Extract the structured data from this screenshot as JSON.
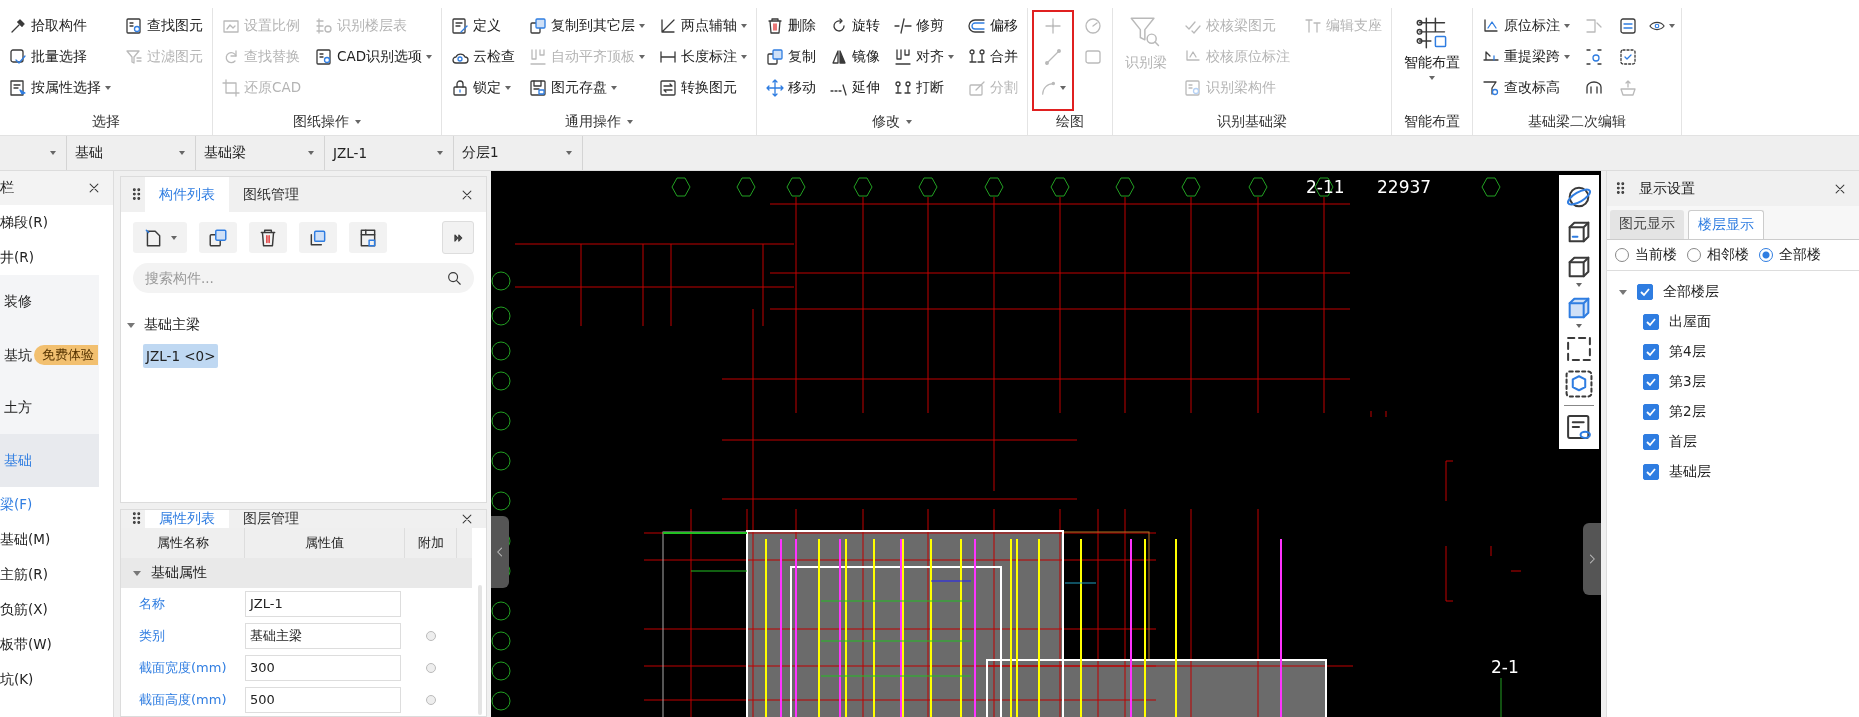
{
  "ribbon": {
    "groups": [
      {
        "label": "选择",
        "has_menu": false,
        "columns": [
          {
            "highlighted": false,
            "items": [
              {
                "kind": "small",
                "label": "拾取构件",
                "disabled": false,
                "has_menu": false
              },
              {
                "kind": "small",
                "label": "批量选择",
                "disabled": false,
                "has_menu": false
              },
              {
                "kind": "small",
                "label": "按属性选择",
                "disabled": false,
                "has_menu": true
              }
            ]
          },
          {
            "highlighted": false,
            "items": [
              {
                "kind": "small",
                "label": "查找图元",
                "disabled": false,
                "has_menu": false
              },
              {
                "kind": "small",
                "label": "过滤图元",
                "disabled": true,
                "has_menu": false
              }
            ]
          }
        ]
      },
      {
        "label": "图纸操作",
        "has_menu": true,
        "columns": [
          {
            "highlighted": false,
            "items": [
              {
                "kind": "small",
                "label": "设置比例",
                "disabled": true,
                "has_menu": false
              },
              {
                "kind": "small",
                "label": "查找替换",
                "disabled": true,
                "has_menu": false
              },
              {
                "kind": "small",
                "label": "还原CAD",
                "disabled": true,
                "has_menu": false
              }
            ]
          },
          {
            "highlighted": false,
            "items": [
              {
                "kind": "small",
                "label": "识别楼层表",
                "disabled": true,
                "has_menu": false
              },
              {
                "kind": "small",
                "label": "CAD识别选项",
                "disabled": false,
                "has_menu": true
              }
            ]
          }
        ]
      },
      {
        "label": "通用操作",
        "has_menu": true,
        "columns": [
          {
            "highlighted": false,
            "items": [
              {
                "kind": "small",
                "label": "定义",
                "disabled": false,
                "has_menu": false
              },
              {
                "kind": "small",
                "label": "云检查",
                "disabled": false,
                "has_menu": false
              },
              {
                "kind": "small",
                "label": "锁定",
                "disabled": false,
                "has_menu": true
              }
            ]
          },
          {
            "highlighted": false,
            "items": [
              {
                "kind": "small",
                "label": "复制到其它层",
                "disabled": false,
                "has_menu": true
              },
              {
                "kind": "small",
                "label": "自动平齐顶板",
                "disabled": true,
                "has_menu": true
              },
              {
                "kind": "small",
                "label": "图元存盘",
                "disabled": false,
                "has_menu": true
              }
            ]
          },
          {
            "highlighted": false,
            "items": [
              {
                "kind": "small",
                "label": "两点辅轴",
                "disabled": false,
                "has_menu": true
              },
              {
                "kind": "small",
                "label": "长度标注",
                "disabled": false,
                "has_menu": true
              },
              {
                "kind": "small",
                "label": "转换图元",
                "disabled": false,
                "has_menu": false
              }
            ]
          }
        ]
      },
      {
        "label": "修改",
        "has_menu": true,
        "columns": [
          {
            "highlighted": false,
            "items": [
              {
                "kind": "small",
                "label": "删除",
                "disabled": false,
                "has_menu": false
              },
              {
                "kind": "small",
                "label": "复制",
                "disabled": false,
                "has_menu": false
              },
              {
                "kind": "small",
                "label": "移动",
                "disabled": false,
                "has_menu": false
              }
            ]
          },
          {
            "highlighted": false,
            "items": [
              {
                "kind": "small",
                "label": "旋转",
                "disabled": false,
                "has_menu": false
              },
              {
                "kind": "small",
                "label": "镜像",
                "disabled": false,
                "has_menu": false
              },
              {
                "kind": "small",
                "label": "延伸",
                "disabled": false,
                "has_menu": false
              }
            ]
          },
          {
            "highlighted": false,
            "items": [
              {
                "kind": "small",
                "label": "修剪",
                "disabled": false,
                "has_menu": false
              },
              {
                "kind": "small",
                "label": "对齐",
                "disabled": false,
                "has_menu": true
              },
              {
                "kind": "small",
                "label": "打断",
                "disabled": false,
                "has_menu": false
              }
            ]
          },
          {
            "highlighted": false,
            "items": [
              {
                "kind": "small",
                "label": "偏移",
                "disabled": false,
                "has_menu": false
              },
              {
                "kind": "small",
                "label": "合并",
                "disabled": false,
                "has_menu": false
              },
              {
                "kind": "small",
                "label": "分割",
                "disabled": true,
                "has_menu": false
              }
            ]
          }
        ]
      },
      {
        "label": "绘图",
        "has_menu": false,
        "columns": [
          {
            "highlighted": true,
            "items": [
              {
                "kind": "icon",
                "disabled": true,
                "has_menu": false
              },
              {
                "kind": "icon",
                "disabled": true,
                "has_menu": false
              },
              {
                "kind": "icon",
                "disabled": true,
                "has_menu": true
              }
            ]
          },
          {
            "highlighted": false,
            "items": [
              {
                "kind": "icon",
                "disabled": true,
                "has_menu": false
              },
              {
                "kind": "icon",
                "disabled": true,
                "has_menu": false
              }
            ]
          }
        ]
      },
      {
        "label": "识别基础梁",
        "has_menu": false,
        "columns": [
          {
            "highlighted": false,
            "items": [
              {
                "kind": "large",
                "label": "识别梁",
                "disabled": true,
                "has_menu": false
              }
            ]
          },
          {
            "highlighted": false,
            "items": [
              {
                "kind": "small",
                "label": "校核梁图元",
                "disabled": true,
                "has_menu": false
              },
              {
                "kind": "small",
                "label": "校核原位标注",
                "disabled": true,
                "has_menu": false
              },
              {
                "kind": "small",
                "label": "识别梁构件",
                "disabled": true,
                "has_menu": false
              }
            ]
          },
          {
            "highlighted": false,
            "items": [
              {
                "kind": "small",
                "label": "编辑支座",
                "disabled": true,
                "has_menu": false
              }
            ]
          }
        ]
      },
      {
        "label": "智能布置",
        "has_menu": false,
        "columns": [
          {
            "highlighted": false,
            "items": [
              {
                "kind": "large",
                "label": "智能布置",
                "disabled": false,
                "has_menu": true
              }
            ]
          }
        ]
      },
      {
        "label": "基础梁二次编辑",
        "has_menu": false,
        "columns": [
          {
            "highlighted": false,
            "items": [
              {
                "kind": "small",
                "label": "原位标注",
                "disabled": false,
                "has_menu": true
              },
              {
                "kind": "small",
                "label": "重提梁跨",
                "disabled": false,
                "has_menu": true
              },
              {
                "kind": "small",
                "label": "查改标高",
                "disabled": false,
                "has_menu": false
              }
            ]
          },
          {
            "highlighted": false,
            "items": [
              {
                "kind": "icon",
                "disabled": true,
                "has_menu": false
              },
              {
                "kind": "icon",
                "disabled": false,
                "has_menu": false
              },
              {
                "kind": "icon",
                "disabled": false,
                "has_menu": false
              }
            ]
          },
          {
            "highlighted": false,
            "items": [
              {
                "kind": "icon",
                "disabled": false,
                "has_menu": false
              },
              {
                "kind": "icon",
                "disabled": false,
                "has_menu": false
              },
              {
                "kind": "icon",
                "disabled": true,
                "has_menu": false
              }
            ]
          },
          {
            "highlighted": false,
            "items": [
              {
                "kind": "icon",
                "disabled": false,
                "has_menu": true
              }
            ]
          }
        ]
      }
    ]
  },
  "selectors": [
    {
      "kind": "blank"
    },
    {
      "kind": "text",
      "value": "基础"
    },
    {
      "kind": "text",
      "value": "基础梁"
    },
    {
      "kind": "text",
      "value": "JZL-1"
    },
    {
      "kind": "text",
      "value": "分层1"
    }
  ],
  "nav": {
    "title": "栏",
    "items": [
      {
        "kind": "item",
        "label": "梯段(R)",
        "selected": false
      },
      {
        "kind": "item",
        "label": "井(R)",
        "selected": false
      },
      {
        "kind": "group",
        "label": "装修",
        "selected": false
      },
      {
        "kind": "group",
        "label": "基坑",
        "badge": "免费体验",
        "selected": false
      },
      {
        "kind": "group",
        "label": "土方",
        "selected": false
      },
      {
        "kind": "group",
        "label": "基础",
        "selected": true
      },
      {
        "kind": "item",
        "label": "梁(F)",
        "selected": true
      },
      {
        "kind": "item",
        "label": "基础(M)",
        "selected": false
      },
      {
        "kind": "item",
        "label": "主筋(R)",
        "selected": false
      },
      {
        "kind": "item",
        "label": "负筋(X)",
        "selected": false
      },
      {
        "kind": "item",
        "label": "板带(W)",
        "selected": false
      },
      {
        "kind": "item",
        "label": "坑(K)",
        "selected": false
      }
    ]
  },
  "components": {
    "tabs": [
      {
        "label": "构件列表",
        "selected": true
      },
      {
        "label": "图纸管理",
        "selected": false
      }
    ],
    "search": {
      "placeholder": "搜索构件..."
    },
    "tree": [
      {
        "label": "基础主梁",
        "expanded": true,
        "selected": false,
        "children": [
          {
            "label": "JZL-1 <0>",
            "selected": true
          }
        ]
      }
    ]
  },
  "properties": {
    "tabs": [
      {
        "label": "属性列表",
        "selected": true
      },
      {
        "label": "图层管理",
        "selected": false
      }
    ],
    "columns": [
      "属性名称",
      "属性值",
      "附加"
    ],
    "groups": [
      {
        "label": "基础属性",
        "expanded": true,
        "rows": [
          {
            "name": "名称",
            "value": "JZL-1",
            "attachable": false
          },
          {
            "name": "类别",
            "value": "基础主梁",
            "attachable": true
          },
          {
            "name": "截面宽度(mm)",
            "value": "300",
            "attachable": true
          },
          {
            "name": "截面高度(mm)",
            "value": "500",
            "attachable": true
          }
        ]
      }
    ]
  },
  "canvas": {
    "labels": [
      "2-11",
      "22937",
      "2-1"
    ]
  },
  "display": {
    "title": "显示设置",
    "tabs": [
      {
        "label": "图元显示",
        "selected": false
      },
      {
        "label": "楼层显示",
        "selected": true
      }
    ],
    "scope": [
      {
        "label": "当前楼",
        "selected": false
      },
      {
        "label": "相邻楼",
        "selected": false
      },
      {
        "label": "全部楼",
        "selected": true
      }
    ],
    "floors": [
      {
        "label": "全部楼层",
        "checked": true,
        "expanded": true,
        "children": [
          {
            "label": "出屋面",
            "checked": true
          },
          {
            "label": "第4层",
            "checked": true
          },
          {
            "label": "第3层",
            "checked": true
          },
          {
            "label": "第2层",
            "checked": true
          },
          {
            "label": "首层",
            "checked": true
          },
          {
            "label": "基础层",
            "checked": true
          }
        ]
      }
    ]
  }
}
